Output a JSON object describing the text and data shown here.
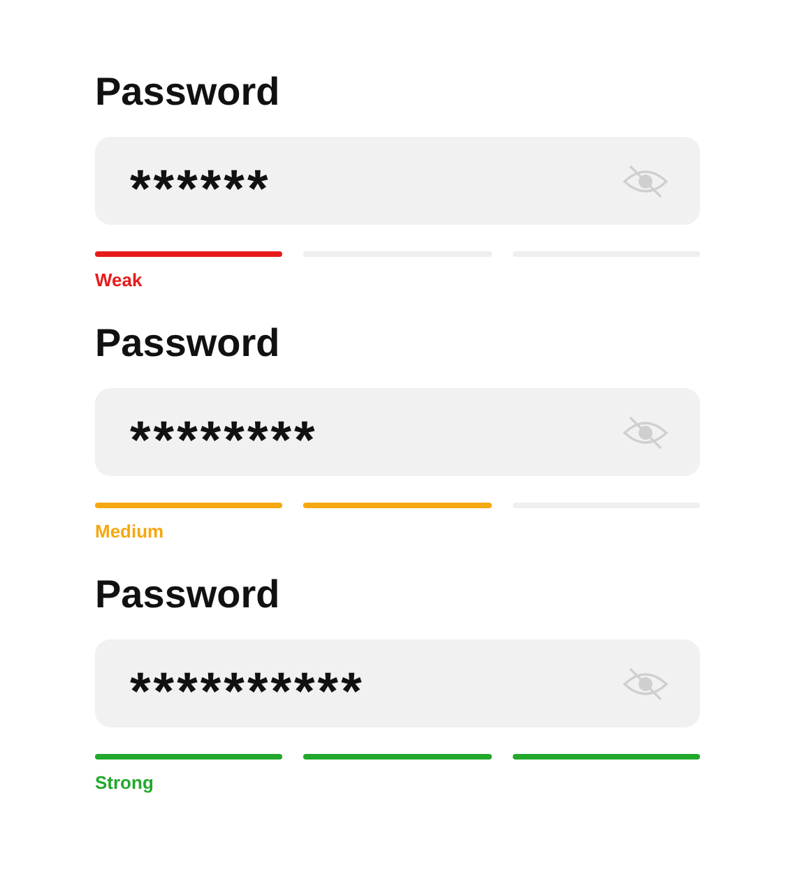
{
  "fields": [
    {
      "label": "Password",
      "value": "******",
      "strength": "Weak",
      "color": "#e61b1b",
      "segments": [
        {
          "filled": true
        },
        {
          "filled": false
        },
        {
          "filled": false
        }
      ]
    },
    {
      "label": "Password",
      "value": "********",
      "strength": "Medium",
      "color": "#f5a812",
      "segments": [
        {
          "filled": true
        },
        {
          "filled": true
        },
        {
          "filled": false
        }
      ]
    },
    {
      "label": "Password",
      "value": "**********",
      "strength": "Strong",
      "color": "#22a82c",
      "segments": [
        {
          "filled": true
        },
        {
          "filled": true
        },
        {
          "filled": true
        }
      ]
    }
  ]
}
